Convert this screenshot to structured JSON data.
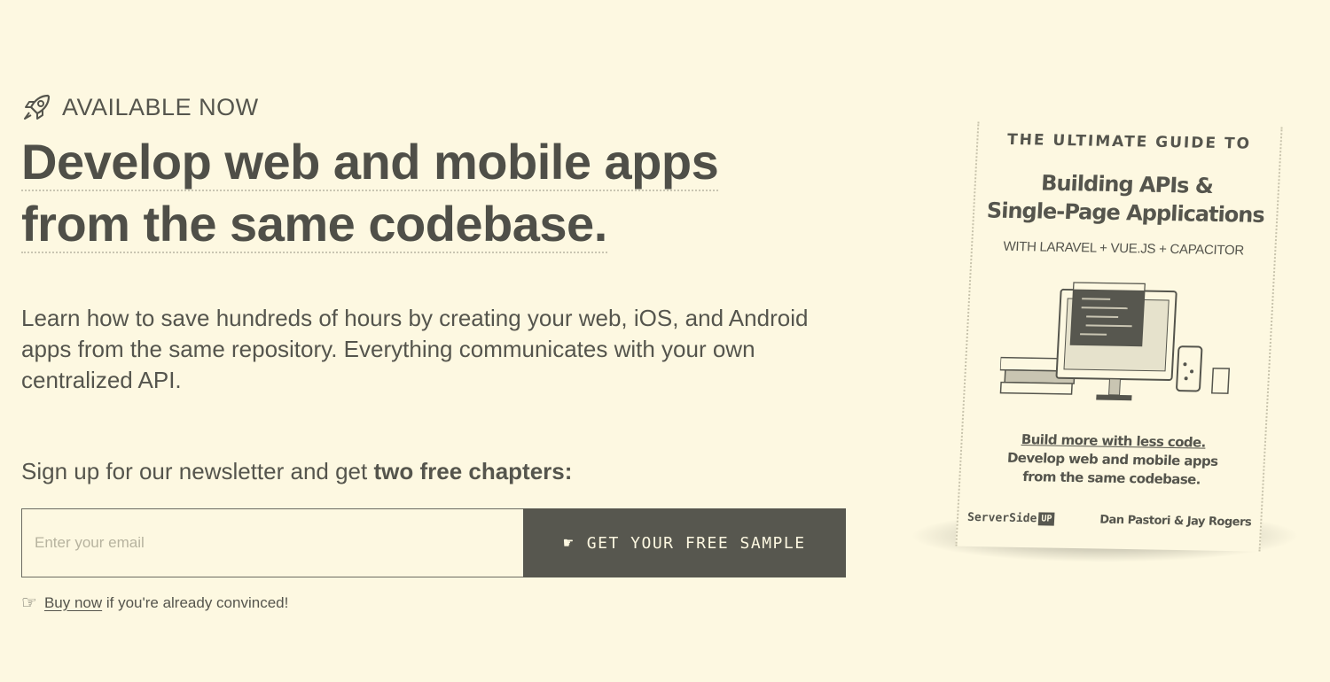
{
  "hero": {
    "eyebrow": "AVAILABLE NOW",
    "headline_line1": "Develop web and mobile apps",
    "headline_line2": "from the same codebase.",
    "lede": "Learn how to save hundreds of hours by creating your web, iOS, and Android apps from the same repository. Everything communicates with your own centralized API.",
    "signup_prefix": "Sign up for our newsletter and get ",
    "signup_bold": "two free chapters:",
    "email_placeholder": "Enter your email",
    "cta_label": "GET YOUR FREE SAMPLE",
    "buy_link": "Buy now",
    "buy_suffix": " if you're already convinced!"
  },
  "book": {
    "kicker": "THE ULTIMATE GUIDE TO",
    "title_line1": "Building APIs &",
    "title_line2": "Single-Page Applications",
    "subtitle": "WITH LARAVEL + VUE.JS + CAPACITOR",
    "tagline_underlined": "Build more with less code.",
    "tagline_line2": "Develop web and mobile apps",
    "tagline_line3": "from the same codebase.",
    "publisher": "ServerSide",
    "publisher_badge": "UP",
    "authors": "Dan Pastori & Jay Rogers"
  },
  "icons": {
    "eyebrow": "rocket-icon",
    "cta": "pointing-hand-icon",
    "buy": "pointing-hand-icon"
  },
  "colors": {
    "background": "#fdf8e1",
    "text": "#55554d",
    "button": "#57574f"
  }
}
